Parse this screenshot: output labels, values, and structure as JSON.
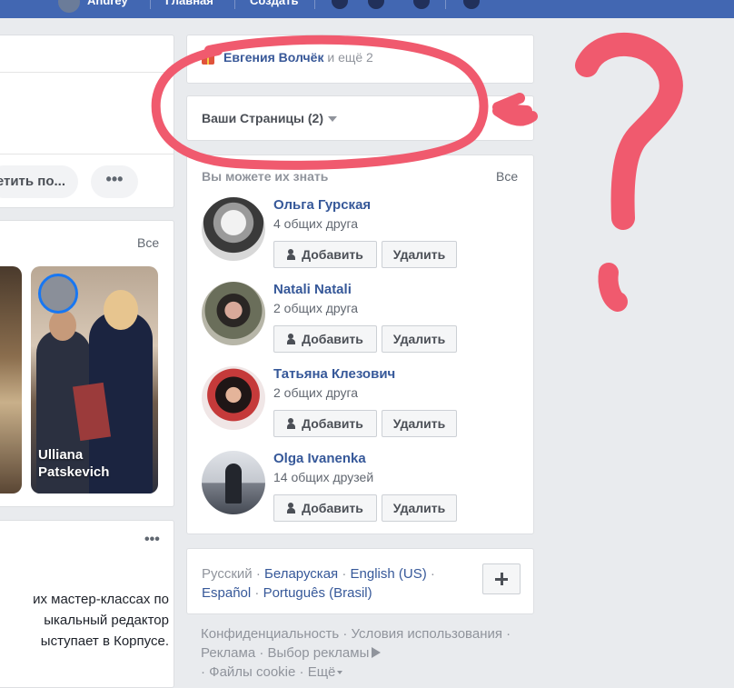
{
  "topbar": {
    "user_name": "Andrey",
    "home": "Главная",
    "create": "Создать"
  },
  "left": {
    "more_action": "етить по...",
    "stories_see_all": "Все",
    "story_name": "Ulliana Patskevich",
    "post_text": [
      "их мастер-классах по",
      "ыкальный редактор",
      "ыступает в Корпусе."
    ]
  },
  "birthday": {
    "name": "Евгения Волчёк",
    "rest": "и ещё 2"
  },
  "pages": {
    "title": "Ваши Страницы (2)"
  },
  "pymk": {
    "title": "Вы можете их знать",
    "see_all": "Все",
    "add_label": "Добавить",
    "remove_label": "Удалить",
    "people": [
      {
        "name": "Ольга Гурская",
        "mutual": "4 общих друга"
      },
      {
        "name": "Natali Natali",
        "mutual": "2 общих друга"
      },
      {
        "name": "Татьяна Клезович",
        "mutual": "2 общих друга"
      },
      {
        "name": "Olga Ivanenka",
        "mutual": "14 общих друзей"
      }
    ]
  },
  "languages": {
    "current": "Русский",
    "items": [
      "Беларуская",
      "English (US)",
      "Español",
      "Português (Brasil)"
    ]
  },
  "footer": {
    "privacy": "Конфиденциальность",
    "terms": "Условия использования",
    "ads": "Реклама",
    "ad_choices": "Выбор рекламы",
    "cookies": "Файлы cookie",
    "more": "Ещё"
  },
  "annotation": {
    "color": "#f05a6e"
  },
  "colors": {
    "brand": "#4267b2",
    "link": "#365899",
    "muted": "#90949c"
  }
}
